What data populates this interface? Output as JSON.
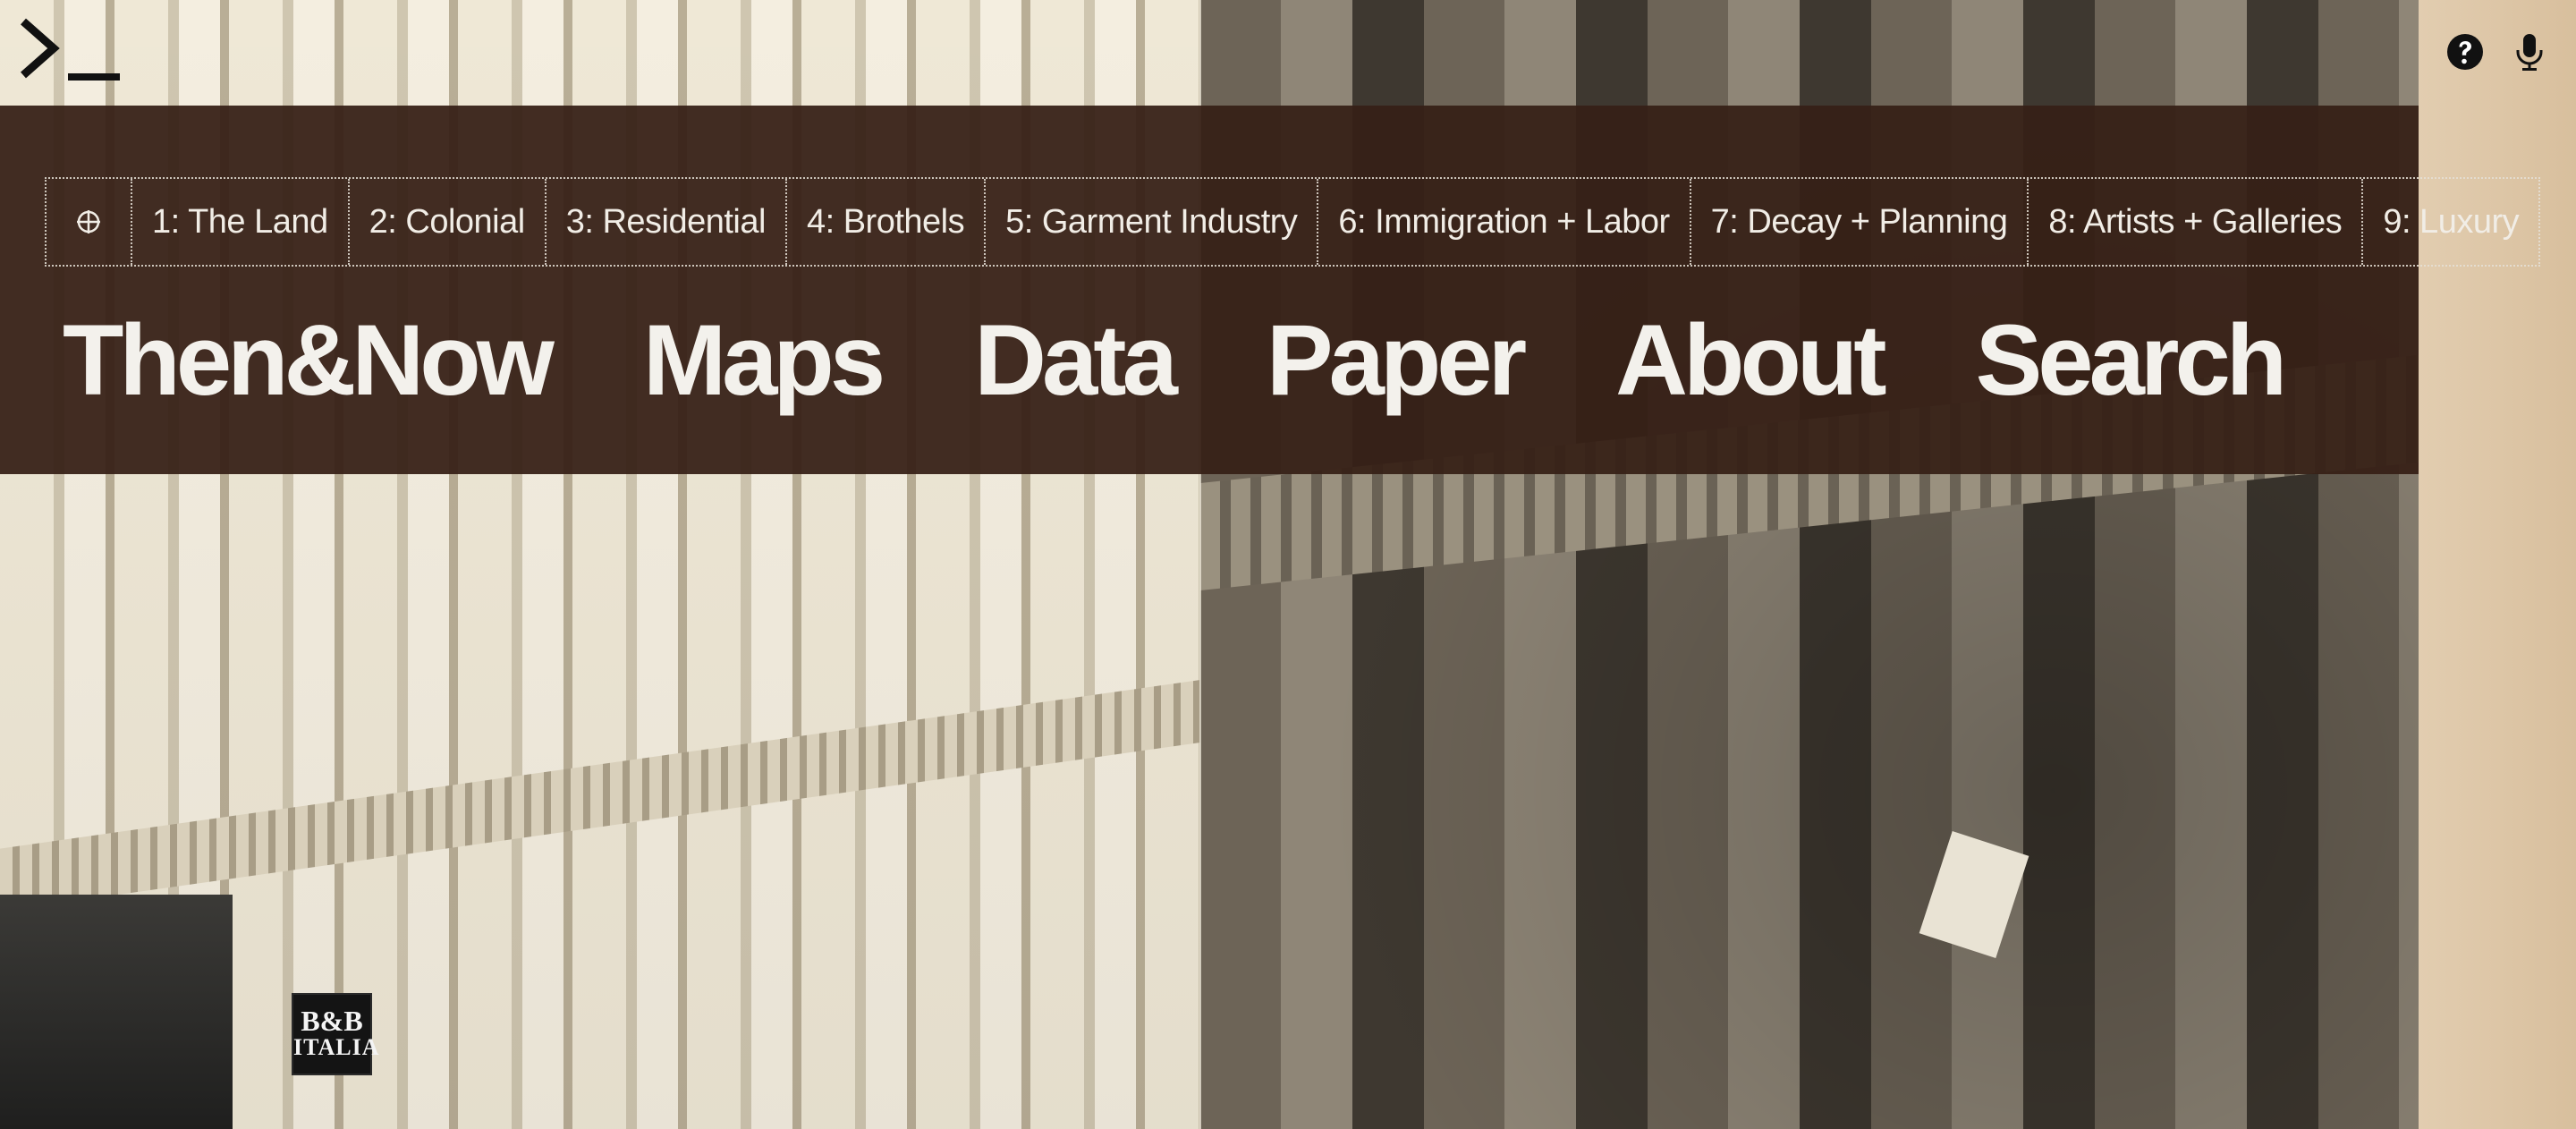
{
  "app": {
    "logo_icon": "terminal-prompt-icon",
    "help_icon": "question-circle-icon",
    "mic_icon": "microphone-icon"
  },
  "chapters": {
    "target_icon": "crosshair-icon",
    "items": [
      {
        "label": "1: The Land"
      },
      {
        "label": "2: Colonial"
      },
      {
        "label": "3: Residential"
      },
      {
        "label": "4: Brothels"
      },
      {
        "label": "5: Garment Industry"
      },
      {
        "label": "6: Immigration + Labor"
      },
      {
        "label": "7: Decay + Planning"
      },
      {
        "label": "8: Artists + Galleries"
      },
      {
        "label": "9: Luxury"
      }
    ]
  },
  "main_nav": {
    "items": [
      {
        "label": "Then&Now"
      },
      {
        "label": "Maps"
      },
      {
        "label": "Data"
      },
      {
        "label": "Paper"
      },
      {
        "label": "About"
      },
      {
        "label": "Search"
      }
    ]
  },
  "background": {
    "store_sign": {
      "line1": "B&B",
      "line2": "ITALIA"
    }
  },
  "colors": {
    "panel": "#362016",
    "text": "#f3f1ec",
    "paper": "#dcc5a3"
  }
}
